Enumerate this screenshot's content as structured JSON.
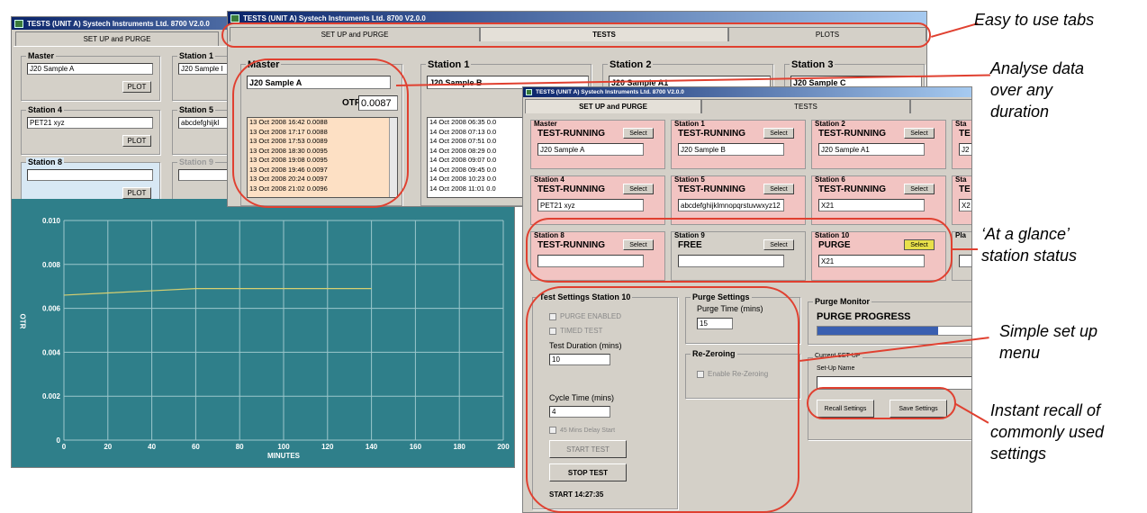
{
  "win1": {
    "title": "TESTS (UNIT A) Systech Instruments Ltd. 8700 V2.0.0",
    "tab": "SET UP and PURGE",
    "stations": [
      {
        "label": "Master",
        "value": "J20 Sample A",
        "btn": "PLOT"
      },
      {
        "label": "Station 1",
        "value": "J20 Sample I"
      },
      {
        "label": "Station 4",
        "value": "PET21 xyz",
        "btn": "PLOT"
      },
      {
        "label": "Station 5",
        "value": "abcdefghijkl"
      },
      {
        "label": "Station 8",
        "value": "",
        "btn": "PLOT"
      },
      {
        "label": "Station 9",
        "value": ""
      }
    ]
  },
  "chart_data": {
    "type": "line",
    "xlabel": "MINUTES",
    "ylabel": "OTR",
    "xlim": [
      0,
      200
    ],
    "ylim": [
      0,
      0.01
    ],
    "x_ticks": [
      "0",
      "20",
      "40",
      "60",
      "80",
      "100",
      "120",
      "140",
      "160",
      "180",
      "200"
    ],
    "y_ticks": [
      "0",
      "0.002",
      "0.004",
      "0.006",
      "0.008",
      "0.010"
    ],
    "series": [
      {
        "x": [
          0,
          20,
          40,
          60,
          80,
          100,
          120,
          140
        ],
        "y": [
          0.0066,
          0.0067,
          0.0068,
          0.0069,
          0.0069,
          0.0069,
          0.0069,
          0.0069
        ],
        "color": "#d8d070"
      }
    ]
  },
  "win2": {
    "title": "TESTS (UNIT A) Systech Instruments Ltd. 8700 V2.0.0",
    "tabs": [
      "SET UP and PURGE",
      "TESTS",
      "PLOTS"
    ],
    "master": "Master",
    "master_value": "J20 Sample A",
    "otr_label": "OTR",
    "otr_value": "0.0087",
    "log": [
      "13 Oct 2008 16:42 0.0088",
      "13 Oct 2008 17:17 0.0088",
      "13 Oct 2008 17:53 0.0089",
      "13 Oct 2008 18:30 0.0095",
      "13 Oct 2008 19:08 0.0095",
      "13 Oct 2008 19:46 0.0097",
      "13 Oct 2008 20:24 0.0097",
      "13 Oct 2008 21:02 0.0096"
    ],
    "log2": [
      "14 Oct 2008 06:35 0.0",
      "14 Oct 2008 07:13 0.0",
      "14 Oct 2008 07:51 0.0",
      "14 Oct 2008 08:29 0.0",
      "14 Oct 2008 09:07 0.0",
      "14 Oct 2008 09:45 0.0",
      "14 Oct 2008 10:23 0.0",
      "14 Oct 2008 11:01 0.0"
    ],
    "st1": "Station 1",
    "st1_value": "J20 Sample B",
    "st2": "Station 2",
    "st2_value": "J20 Sample A1",
    "st3": "Station 3",
    "st3_value": "J20 Sample C",
    "otr_short": "O"
  },
  "win3": {
    "title": "TESTS (UNIT A) Systech Instruments Ltd. 8700 V2.0.0",
    "tabs": [
      "SET UP and PURGE",
      "TESTS"
    ],
    "select": "Select",
    "stations": [
      {
        "label": "Master",
        "status": "TEST-RUNNING",
        "value": "J20 Sample A"
      },
      {
        "label": "Station 1",
        "status": "TEST-RUNNING",
        "value": "J20 Sample B"
      },
      {
        "label": "Station 2",
        "status": "TEST-RUNNING",
        "value": "J20 Sample A1"
      },
      {
        "label": "Sta",
        "status": "TE",
        "value": "J2"
      },
      {
        "label": "Station 4",
        "status": "TEST-RUNNING",
        "value": "PET21 xyz"
      },
      {
        "label": "Station 5",
        "status": "TEST-RUNNING",
        "value": "abcdefghijklmnopqrstuvwxyz12"
      },
      {
        "label": "Station 6",
        "status": "TEST-RUNNING",
        "value": "X21"
      },
      {
        "label": "Sta",
        "status": "TE",
        "value": "X2"
      },
      {
        "label": "Station 8",
        "status": "TEST-RUNNING",
        "value": ""
      },
      {
        "label": "Station 9",
        "status": "FREE",
        "value": ""
      },
      {
        "label": "Station 10",
        "status": "PURGE",
        "value": "X21"
      },
      {
        "label": "Pla",
        "status": "",
        "value": ""
      }
    ],
    "test_settings": "Test Settings Station 10",
    "purge_enabled": "PURGE ENABLED",
    "timed_test": "TIMED TEST",
    "test_duration": "Test Duration (mins)",
    "test_duration_value": "10",
    "cycle_time": "Cycle Time (mins)",
    "cycle_time_value": "4",
    "delay": "45 Mins Delay Start",
    "start_test": "START TEST",
    "stop_test": "STOP TEST",
    "start_time": "START 14:27:35",
    "purge_settings": "Purge Settings",
    "purge_time": "Purge Time (mins)",
    "purge_time_value": "15",
    "rezero": "Re-Zeroing",
    "enable_rezero": "Enable Re-Zeroing",
    "purge_monitor": "Purge Monitor",
    "purge_progress": "PURGE PROGRESS",
    "purge_progress_fraction": 0.78,
    "current_setup": "Current SET-UP",
    "setup_name": "Set-Up Name",
    "setup_value": "",
    "recall": "Recall Settings",
    "save": "Save Settings"
  },
  "callouts": {
    "tabs": "Easy to use tabs",
    "analyse": "Analyse data\nover any\nduration",
    "glance": "‘At a glance’\nstation status",
    "setup": "Simple set up\nmenu",
    "recall": "Instant recall of\ncommonly used\nsettings"
  },
  "colors": {
    "chart_bg": "#2f7f8a",
    "station_running": "#f2c4c2",
    "callout_red": "#e04030",
    "progress": "#3a5fb0"
  }
}
